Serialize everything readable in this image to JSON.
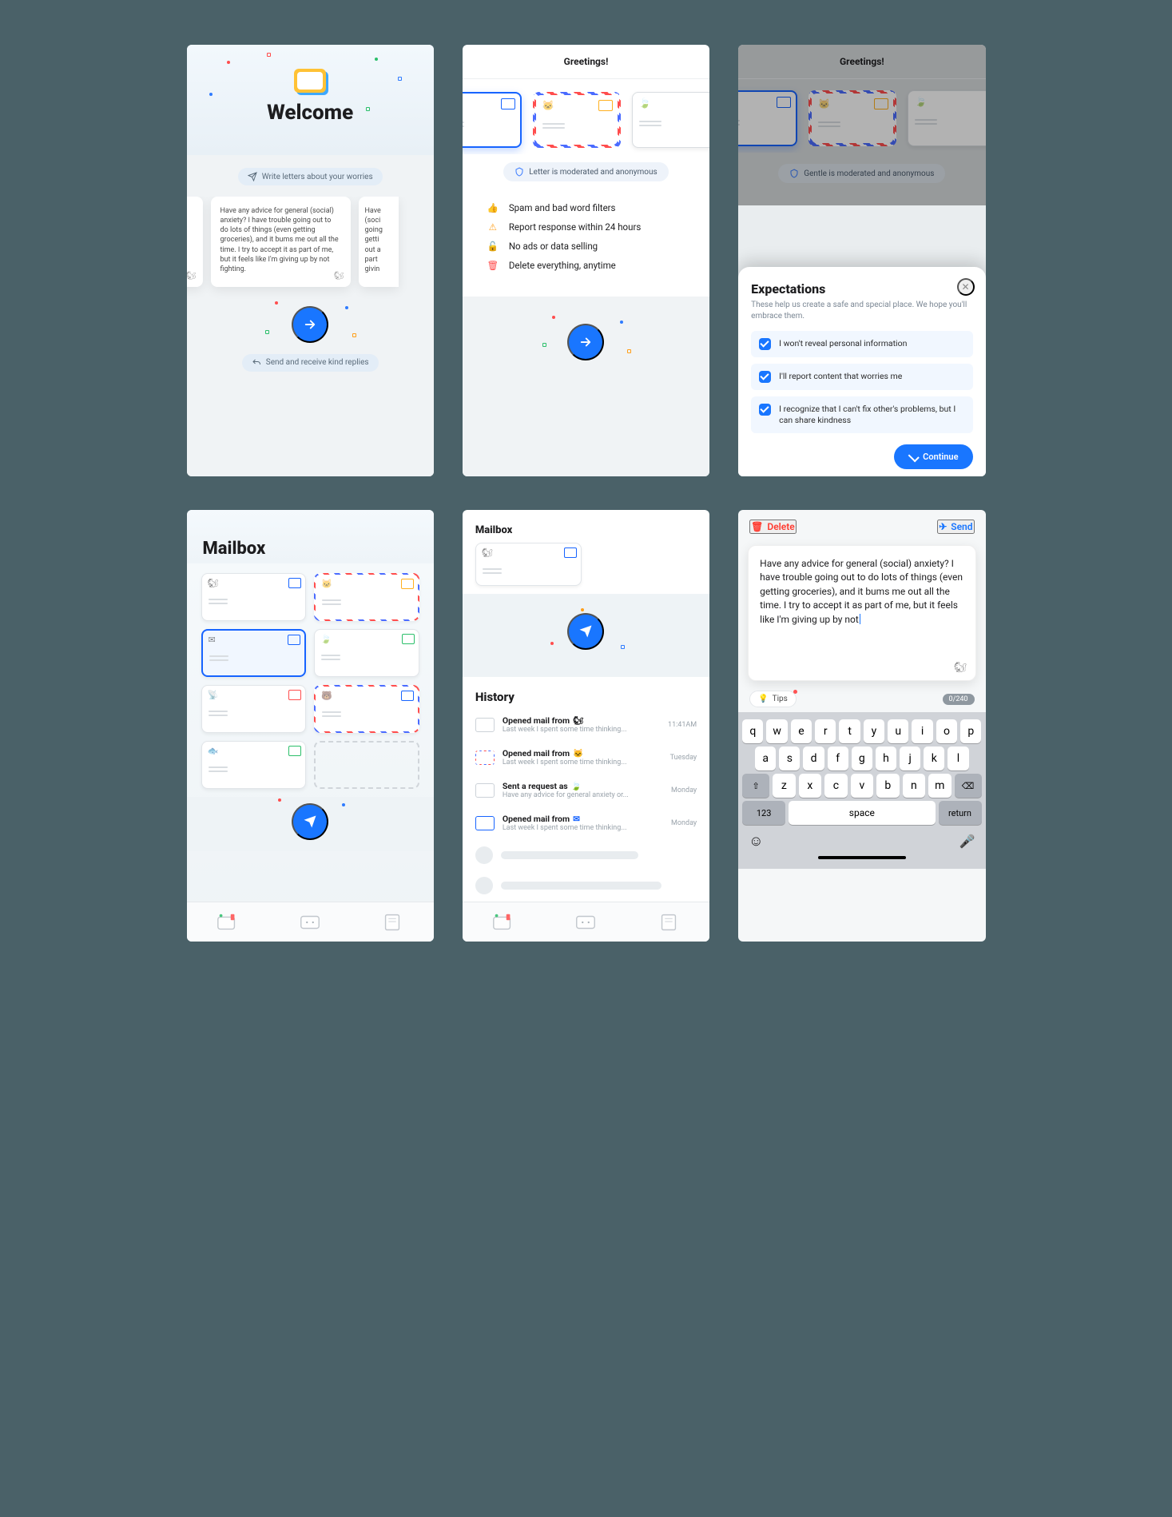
{
  "screen1": {
    "title": "Welcome",
    "tagline_top": "Write letters about your worries",
    "card_text": "Have any advice for general (social) anxiety? I have trouble going out to do lots of things (even getting groceries), and it bums me out all the time. I try to accept it as part of me, but it feels like I'm giving up by not fighting.",
    "card_left_partial": "even\ns me\nit as",
    "card_right_partial": "Have\n(soci\ngoing\ngetti\nout a\npart\ngivin",
    "tagline_bottom": "Send and receive kind replies"
  },
  "screen2": {
    "header": "Greetings!",
    "moderation_badge": "Letter is moderated and anonymous",
    "features": [
      {
        "icon": "👍",
        "color": "#2f7bff",
        "text": "Spam and bad word filters"
      },
      {
        "icon": "⚠",
        "color": "#ff9f1a",
        "text": "Report response within 24 hours"
      },
      {
        "icon": "🔒",
        "color": "#2bbf6a",
        "text": "No ads or data selling"
      },
      {
        "icon": "🗑",
        "color": "#ff4d4d",
        "text": "Delete everything, anytime"
      }
    ]
  },
  "screen3": {
    "header": "Greetings!",
    "moderation_badge": "Gentle is moderated and anonymous",
    "sheet_title": "Expectations",
    "sheet_sub": "These help us create a safe and special place. We hope you'll embrace them.",
    "checks": [
      "I won't reveal personal information",
      "I'll report content that worries me",
      "I recognize that I can't fix other's problems, but I can share kindness"
    ],
    "continue": "Continue"
  },
  "screen4": {
    "title": "Mailbox"
  },
  "screen5": {
    "title": "Mailbox",
    "history_title": "History",
    "rows": [
      {
        "kind": "plain",
        "action": "Opened mail from",
        "who": "🐿",
        "sub": "Last week I spent some time thinking...",
        "time": "11:41AM"
      },
      {
        "kind": "stripe",
        "action": "Opened mail from",
        "who": "🐱",
        "sub": "Last week I spent some time thinking...",
        "time": "Tuesday"
      },
      {
        "kind": "plain",
        "action": "Sent a request as",
        "who": "🍃",
        "sub": "Have any advice for general anxiety or...",
        "time": "Monday"
      },
      {
        "kind": "blue",
        "action": "Opened mail from",
        "who": "✉",
        "sub": "Last week I spent some time thinking...",
        "time": "Monday"
      }
    ]
  },
  "screen6": {
    "delete": "Delete",
    "send": "Send",
    "body": "Have any advice for general (social) anxiety? I have trouble going out to do lots of things (even getting groceries), and it bums me out all the time. I try to accept it as part of me, but it feels like I'm giving up by not",
    "tips": "Tips",
    "counter": "0/240",
    "keyboard": {
      "row1": [
        "q",
        "w",
        "e",
        "r",
        "t",
        "y",
        "u",
        "i",
        "o",
        "p"
      ],
      "row2": [
        "a",
        "s",
        "d",
        "f",
        "g",
        "h",
        "j",
        "k",
        "l"
      ],
      "row3": [
        "z",
        "x",
        "c",
        "v",
        "b",
        "n",
        "m"
      ],
      "numkey": "123",
      "space": "space",
      "return": "return"
    }
  }
}
